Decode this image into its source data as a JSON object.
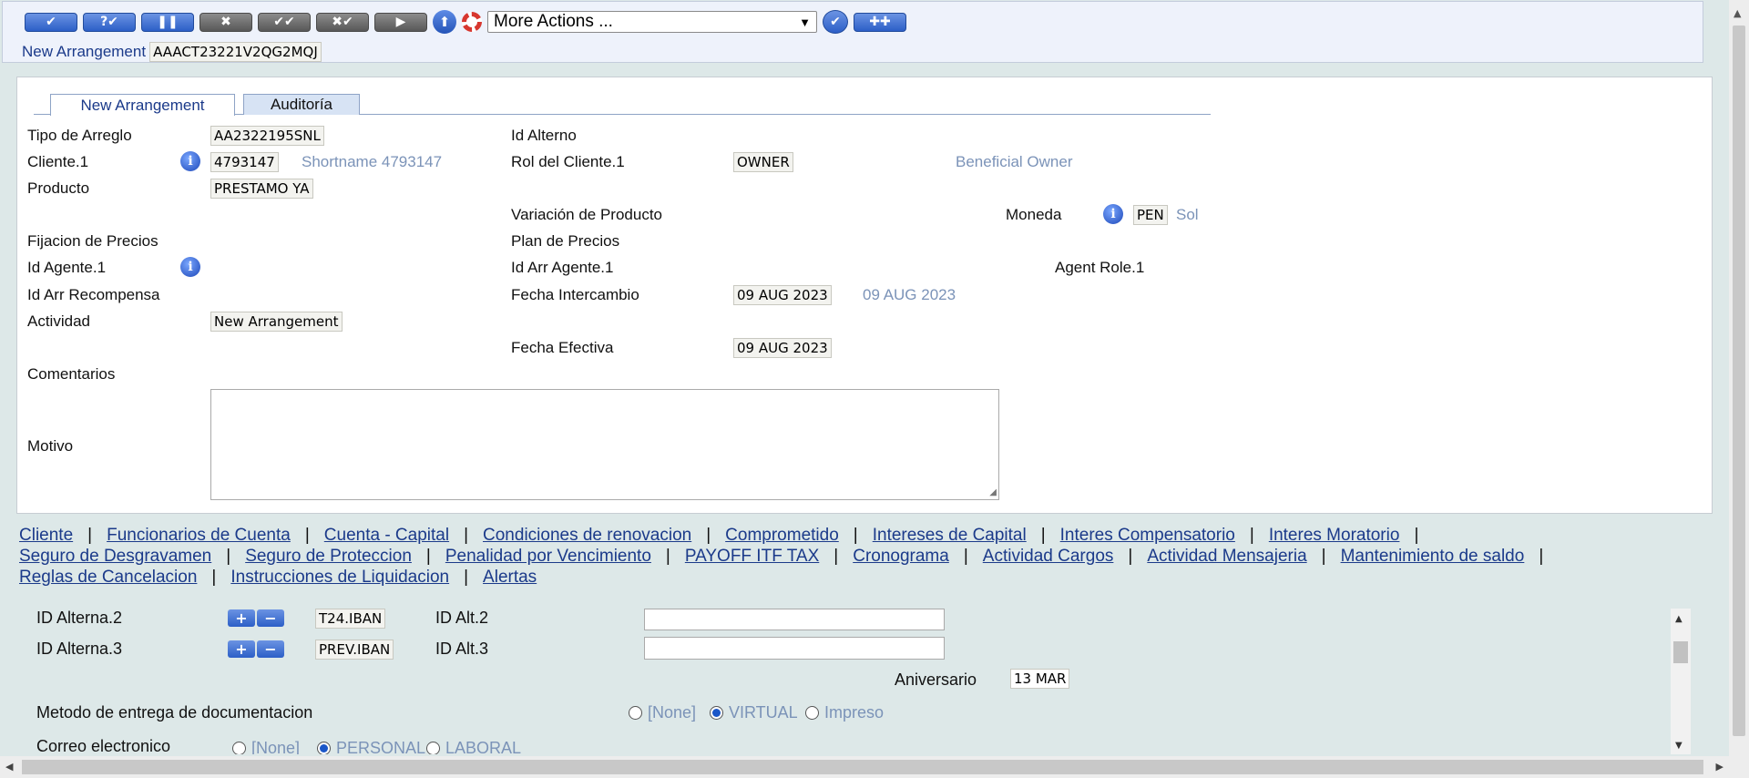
{
  "toolbar": {
    "buttons": [
      "✔",
      "?✔",
      "❚❚",
      "✖",
      "✔✔",
      "✖✔",
      "▶"
    ],
    "more_actions": "More Actions ...",
    "new_arrangement_label": "New Arrangement",
    "arrangement_id": "AAACT23221V2QG2MQJ"
  },
  "tabs": [
    "New Arrangement",
    "Auditoría"
  ],
  "form": {
    "tipo_label": "Tipo de Arreglo",
    "tipo_value": "AA2322195SNL",
    "cliente_label": "Cliente.1",
    "cliente_value": "4793147",
    "cliente_enr": "Shortname 4793147",
    "producto_label": "Producto",
    "producto_value": "PRESTAMO YA",
    "fijacion_label": "Fijacion de Precios",
    "agente_label": "Id Agente.1",
    "recompensa_label": "Id Arr Recompensa",
    "actividad_label": "Actividad",
    "actividad_value": "New Arrangement",
    "comentarios_label": "Comentarios",
    "motivo_label": "Motivo",
    "alterno_label": "Id Alterno",
    "rol_label": "Rol del Cliente.1",
    "rol_value": "OWNER",
    "rol_enr": "Beneficial Owner",
    "variacion_label": "Variación de Producto",
    "plan_label": "Plan de Precios",
    "arr_agente_label": "Id Arr Agente.1",
    "intercambio_label": "Fecha Intercambio",
    "intercambio_value": "09 AUG 2023",
    "intercambio_enr": "09 AUG 2023",
    "efectiva_label": "Fecha Efectiva",
    "efectiva_value": "09 AUG 2023",
    "moneda_label": "Moneda",
    "moneda_value": "PEN",
    "moneda_enr": "Sol",
    "agent_role_label": "Agent Role.1"
  },
  "links": [
    "Cliente",
    "Funcionarios de Cuenta",
    "Cuenta - Capital",
    "Condiciones de renovacion",
    "Comprometido",
    "Intereses de Capital",
    "Interes Compensatorio",
    "Interes Moratorio",
    "Seguro de Desgravamen",
    "Seguro de Proteccion",
    "Penalidad por Vencimiento",
    "PAYOFF ITF TAX",
    "Cronograma",
    "Actividad Cargos",
    "Actividad Mensajeria",
    "Mantenimiento de saldo",
    "Reglas de Cancelacion",
    "Instrucciones de Liquidacion",
    "Alertas"
  ],
  "lower": {
    "alt2_label": "ID Alterna.2",
    "alt2_value": "T24.IBAN",
    "alt2_id_label": "ID Alt.2",
    "alt3_label": "ID Alterna.3",
    "alt3_value": "PREV.IBAN",
    "alt3_id_label": "ID Alt.3",
    "aniversario_label": "Aniversario",
    "aniversario_value": "13 MAR",
    "metodo_label": "Metodo de entrega de documentacion",
    "metodo_options": [
      "[None]",
      "VIRTUAL",
      "Impreso"
    ],
    "metodo_selected": "VIRTUAL",
    "correo_label": "Correo electronico",
    "correo_options": [
      "[None]",
      "PERSONAL",
      "LABORAL"
    ],
    "correo_selected": "PERSONAL"
  },
  "colors": {
    "link": "#1b3a8a",
    "enrichment": "#7b93b8",
    "button": "#2c5fc7"
  }
}
